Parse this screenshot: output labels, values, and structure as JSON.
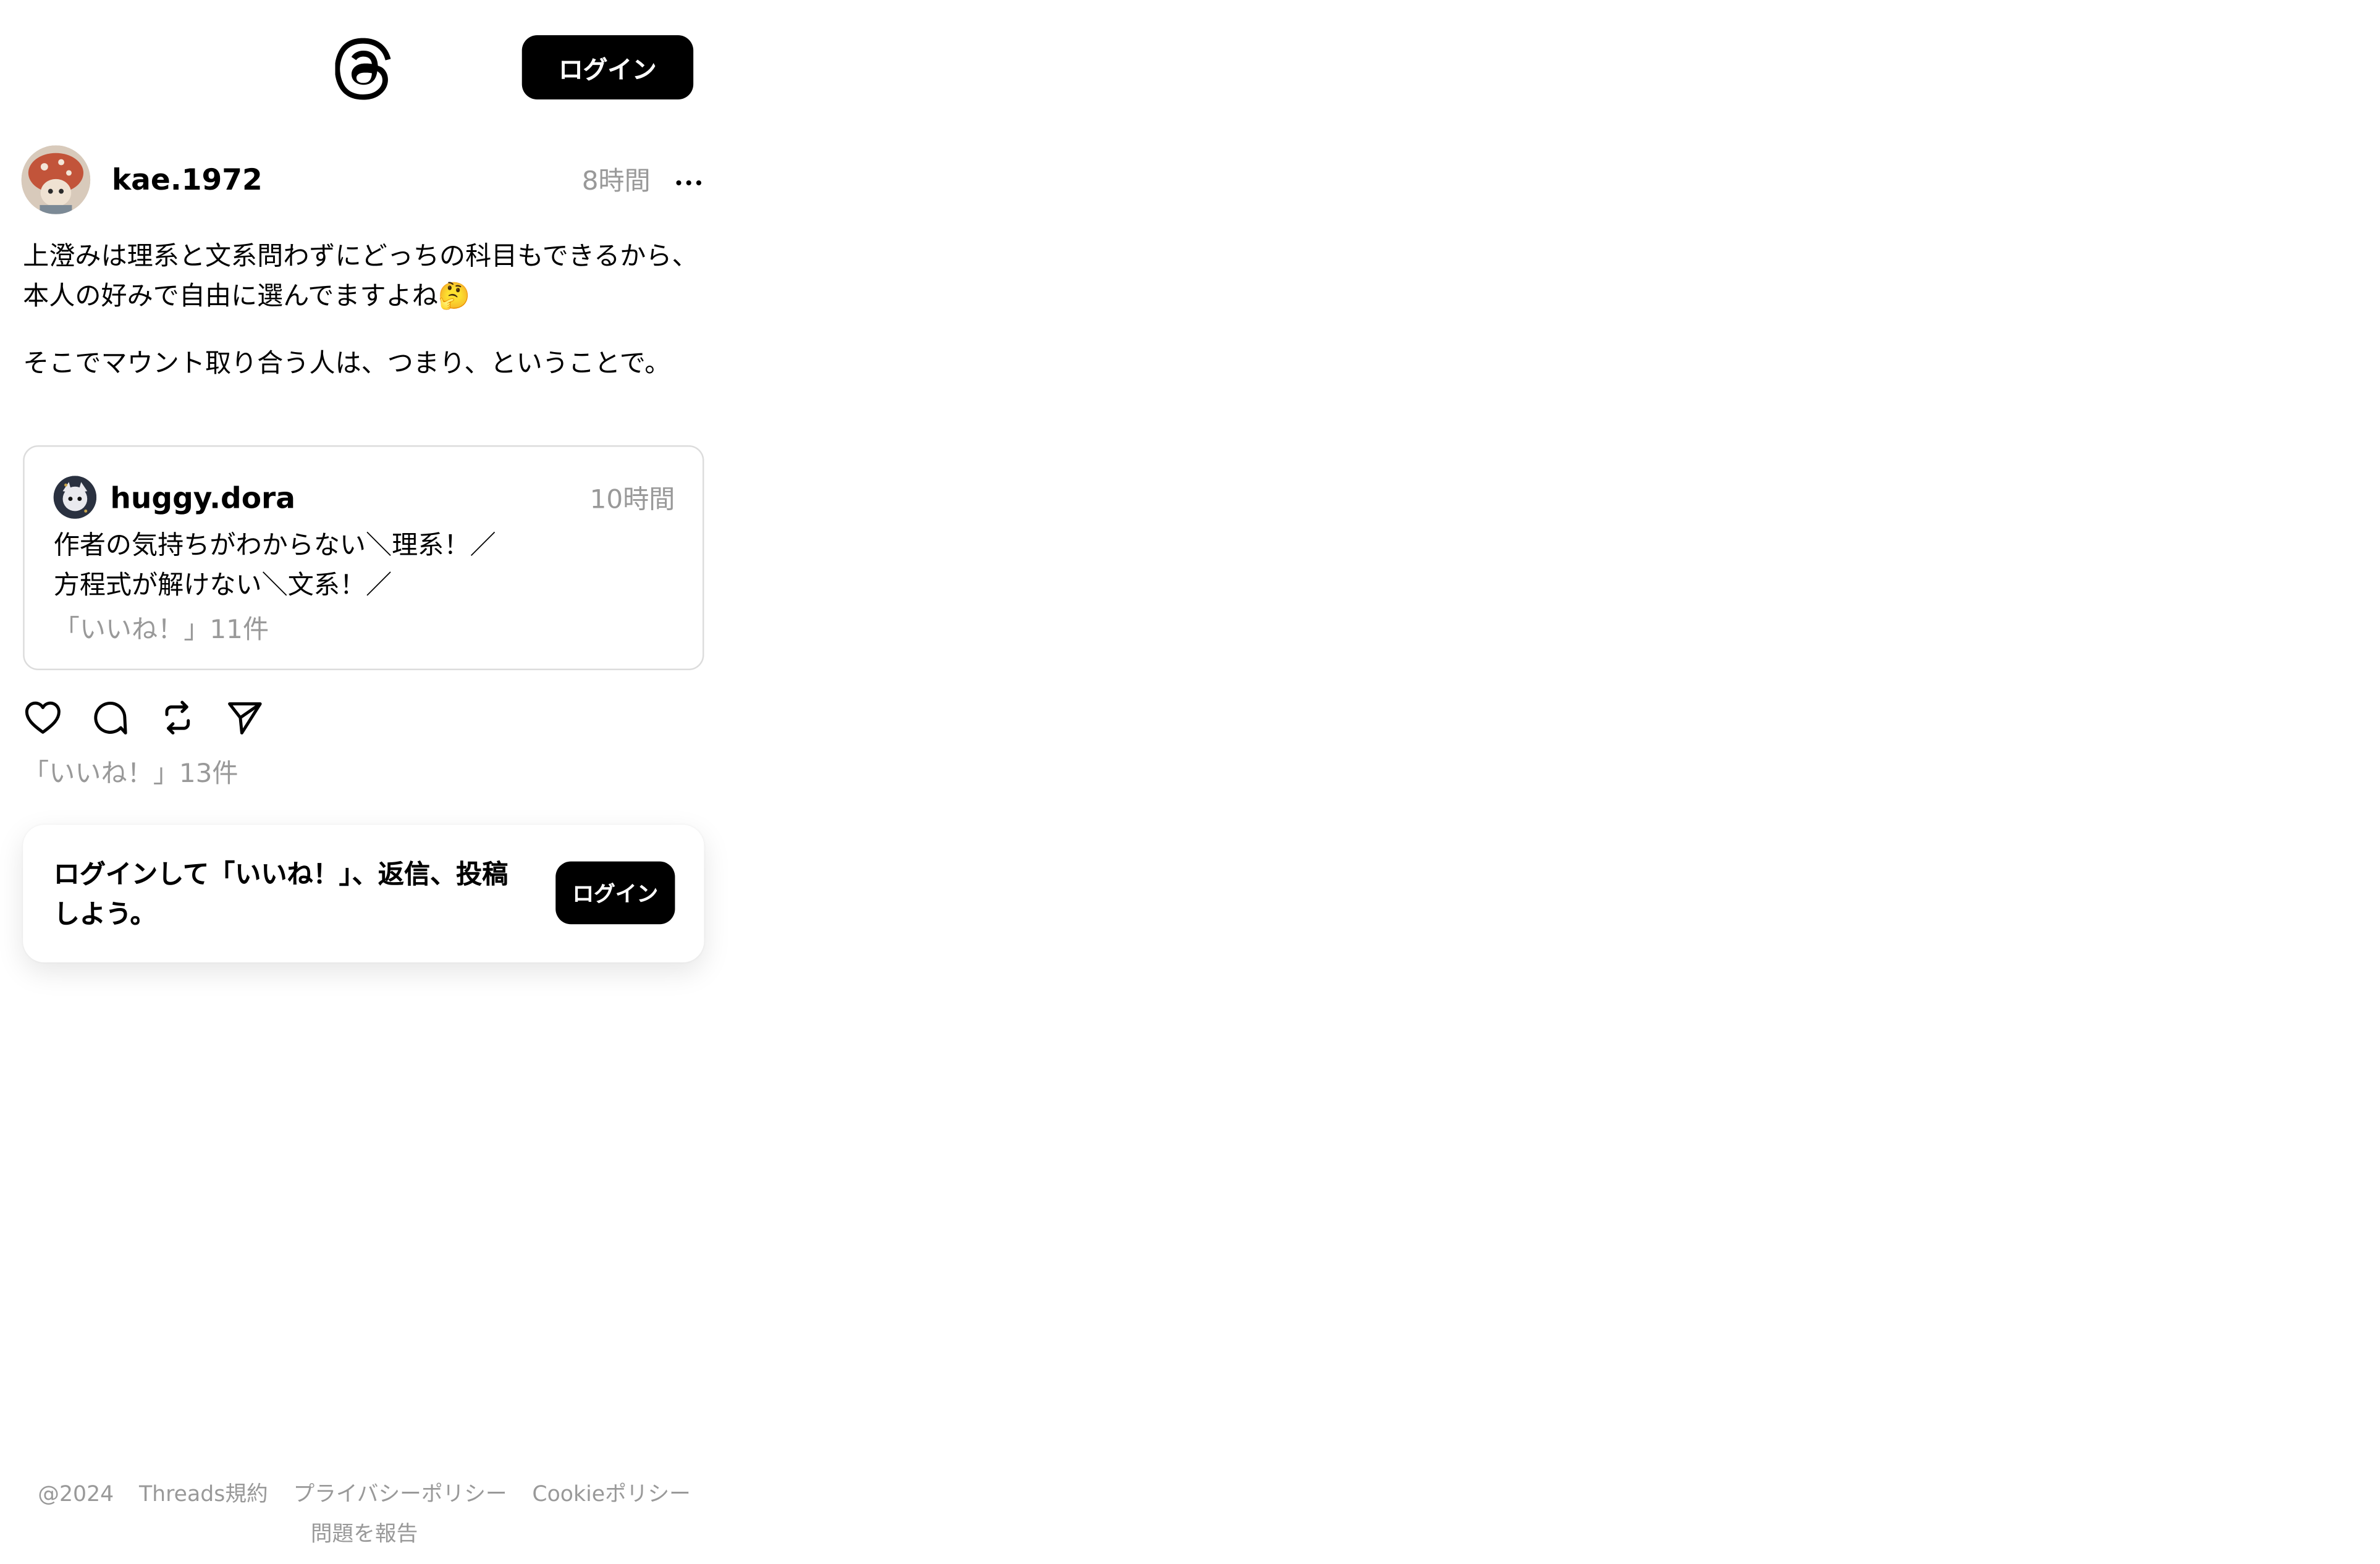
{
  "header": {
    "logo_icon": "threads-logo-icon",
    "login_label": "ログイン"
  },
  "post": {
    "username": "kae.1972",
    "time": "8時間",
    "more_icon": "more-dots-icon",
    "paragraphs": [
      "上澄みは理系と文系問わずにどっちの科目もできるから、本人の好みで自由に選んでますよね🤔",
      "そこでマウント取り合う人は、つまり、ということで。"
    ],
    "quote": {
      "username": "huggy.dora",
      "time": "10時間",
      "lines": [
        "作者の気持ちがわからない＼理系！／",
        "方程式が解けない＼文系！／"
      ],
      "likes": "「いいね！」11件"
    },
    "actions": [
      "heart-icon",
      "comment-icon",
      "repost-icon",
      "share-icon"
    ],
    "likes": "「いいね！」13件"
  },
  "login_prompt": {
    "text": "ログインして「いいね！」、返信、投稿しよう。",
    "button_label": "ログイン"
  },
  "footer": {
    "links": [
      "@2024",
      "Threads規約",
      "プライバシーポリシー",
      "Cookieポリシー"
    ],
    "report": "問題を報告"
  },
  "colors": {
    "primary": "#000000",
    "muted": "#999999",
    "border": "#dcdcdc",
    "background": "#ffffff"
  }
}
